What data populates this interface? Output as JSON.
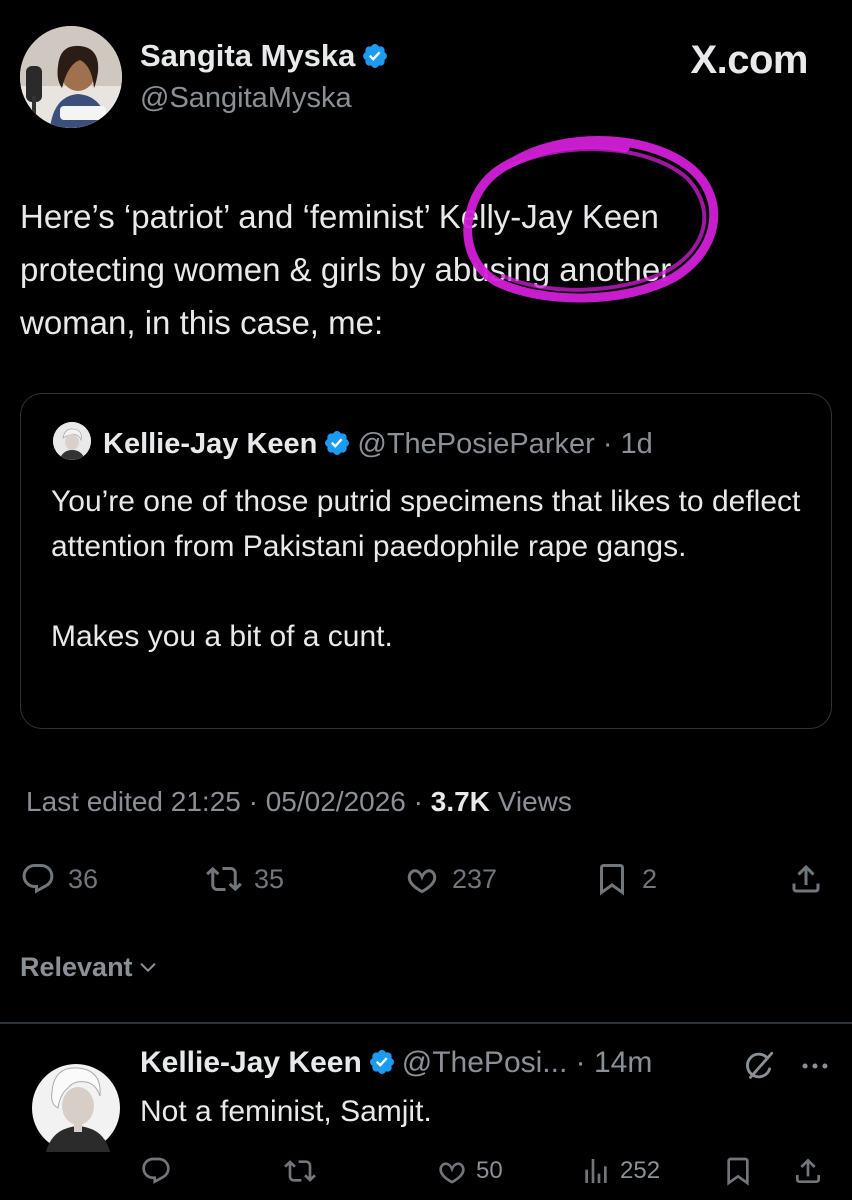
{
  "author": {
    "display_name": "Sangita Myska",
    "handle": "@SangitaMyska"
  },
  "brand": "X.com",
  "tweet": {
    "lines": [
      "Here’s ‘patriot’ and ‘feminist’ Kelly-Jay Keen",
      "protecting women & girls by abusing another",
      "woman, in this case, me:"
    ]
  },
  "quote": {
    "name": "Kellie-Jay Keen",
    "handle_time": "@ThePosieParker · 1d",
    "paragraphs": [
      "You’re one of those putrid specimens that likes to deflect attention from Pakistani paedophile rape gangs.",
      "Makes you a bit of a cunt."
    ]
  },
  "meta": {
    "edited": "Last edited 21:25 · 05/02/2026",
    "sep": " · ",
    "views_count": "3.7K",
    "views_label": " Views"
  },
  "actions": {
    "replies": "36",
    "reposts": "35",
    "likes": "237",
    "bookmarks": "2"
  },
  "filter_label": "Relevant",
  "reply": {
    "name": "Kellie-Jay Keen",
    "handle_time": "@ThePosi... · 14m",
    "text": "Not a feminist,  Samjit.",
    "likes": "50",
    "views": "252"
  },
  "colors": {
    "background": "#000000",
    "verified": "#1d9bf0",
    "highlight_marker": "#d21fd7",
    "muted_text": "#8b9096"
  }
}
